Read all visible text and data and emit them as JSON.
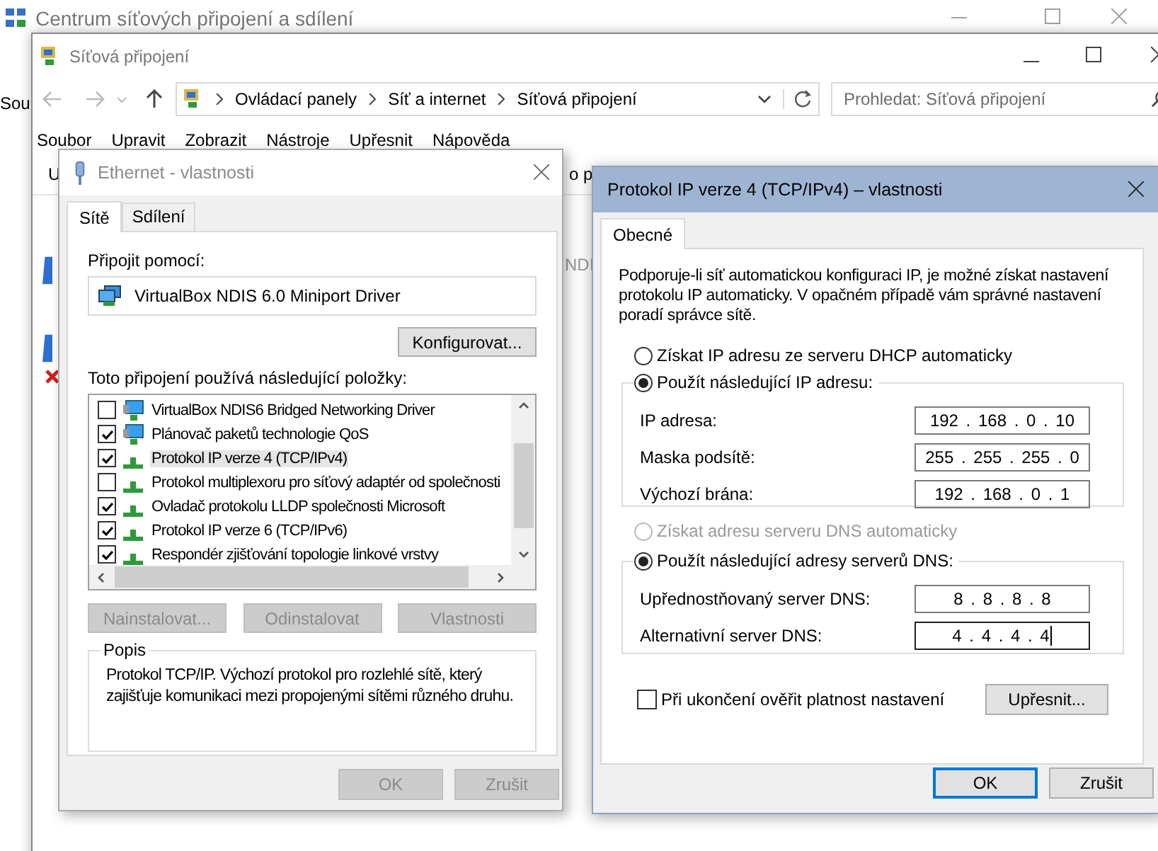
{
  "background_window": {
    "title": "Centrum síťových připojení a sdílení",
    "peek_text": "Sou"
  },
  "explorer": {
    "title": "Síťová připojení",
    "breadcrumbs": [
      "Ovládací panely",
      "Síť a internet",
      "Síťová připojení"
    ],
    "search": {
      "placeholder": "Prohledat: Síťová připojení"
    },
    "menu": [
      "Soubor",
      "Upravit",
      "Zobrazit",
      "Nástroje",
      "Upřesnit",
      "Nápověda"
    ],
    "toolbar_peeks": [
      "U",
      "o p"
    ],
    "content_peek": "NDI"
  },
  "ethernet_dialog": {
    "title": "Ethernet - vlastnosti",
    "active": false,
    "tabs": [
      {
        "label": "Sítě",
        "selected": true
      },
      {
        "label": "Sdílení",
        "selected": false
      }
    ],
    "connect_label": "Připojit pomocí:",
    "adapter": "VirtualBox NDIS 6.0 Miniport Driver",
    "configure_button": "Konfigurovat...",
    "items_label": "Toto připojení používá následující položky:",
    "items": [
      {
        "label": "VirtualBox NDIS6 Bridged Networking Driver",
        "kind": "service",
        "checked": false,
        "selected": false
      },
      {
        "label": "Plánovač paketů technologie QoS",
        "kind": "service",
        "checked": true,
        "selected": false
      },
      {
        "label": "Protokol IP verze 4 (TCP/IPv4)",
        "kind": "protocol",
        "checked": true,
        "selected": true
      },
      {
        "label": "Protokol multiplexoru pro síťový adaptér od společnosti",
        "kind": "protocol",
        "checked": false,
        "selected": false
      },
      {
        "label": "Ovladač protokolu LLDP společnosti Microsoft",
        "kind": "protocol",
        "checked": true,
        "selected": false
      },
      {
        "label": "Protokol IP verze 6 (TCP/IPv6)",
        "kind": "protocol",
        "checked": true,
        "selected": false
      },
      {
        "label": "Respondér zjišťování topologie linkové vrstvy",
        "kind": "protocol",
        "checked": true,
        "selected": false
      }
    ],
    "item_buttons": [
      {
        "label": "Nainstalovat...",
        "disabled": true
      },
      {
        "label": "Odinstalovat",
        "disabled": true
      },
      {
        "label": "Vlastnosti",
        "disabled": true
      }
    ],
    "description": {
      "title": "Popis",
      "text": "Protokol TCP/IP. Výchozí protokol pro rozlehlé sítě, který zajišťuje komunikaci mezi propojenými sítěmi různého druhu."
    },
    "footer_buttons": [
      {
        "label": "OK",
        "disabled": true,
        "default": false
      },
      {
        "label": "Zrušit",
        "disabled": true,
        "default": false
      }
    ]
  },
  "ipv4_dialog": {
    "title": "Protokol IP verze 4 (TCP/IPv4) – vlastnosti",
    "active": true,
    "tabs": [
      {
        "label": "Obecné",
        "selected": true
      }
    ],
    "intro": "Podporuje-li síť automatickou konfiguraci IP, je možné získat nastavení protokolu IP automaticky. V opačném případě vám správné nastavení poradí správce sítě.",
    "ip_auto": {
      "label": "Získat IP adresu ze serveru DHCP automaticky",
      "selected": false,
      "disabled": false
    },
    "ip_manual": {
      "label": "Použít následující IP adresu:",
      "selected": true,
      "disabled": false
    },
    "ip_fields": [
      {
        "label": "IP adresa:",
        "value": "192 . 168 . 0 . 10",
        "focused": false
      },
      {
        "label": "Maska podsítě:",
        "value": "255 . 255 . 255 . 0",
        "focused": false
      },
      {
        "label": "Výchozí brána:",
        "value": "192 . 168 . 0 . 1",
        "focused": false
      }
    ],
    "dns_auto": {
      "label": "Získat adresu serveru DNS automaticky",
      "selected": false,
      "disabled": true
    },
    "dns_manual": {
      "label": "Použít následující adresy serverů DNS:",
      "selected": true,
      "disabled": false
    },
    "dns_fields": [
      {
        "label": "Upřednostňovaný server DNS:",
        "value": "8 . 8 . 8 . 8",
        "focused": false
      },
      {
        "label": "Alternativní server DNS:",
        "value": "4 . 4 . 4 . 4",
        "focused": true
      }
    ],
    "validate": {
      "label": "Při ukončení ověřit platnost nastavení",
      "checked": false
    },
    "advanced_button": "Upřesnit...",
    "footer_buttons": [
      {
        "label": "OK",
        "disabled": false,
        "default": true
      },
      {
        "label": "Zrušit",
        "disabled": false,
        "default": false
      }
    ]
  }
}
